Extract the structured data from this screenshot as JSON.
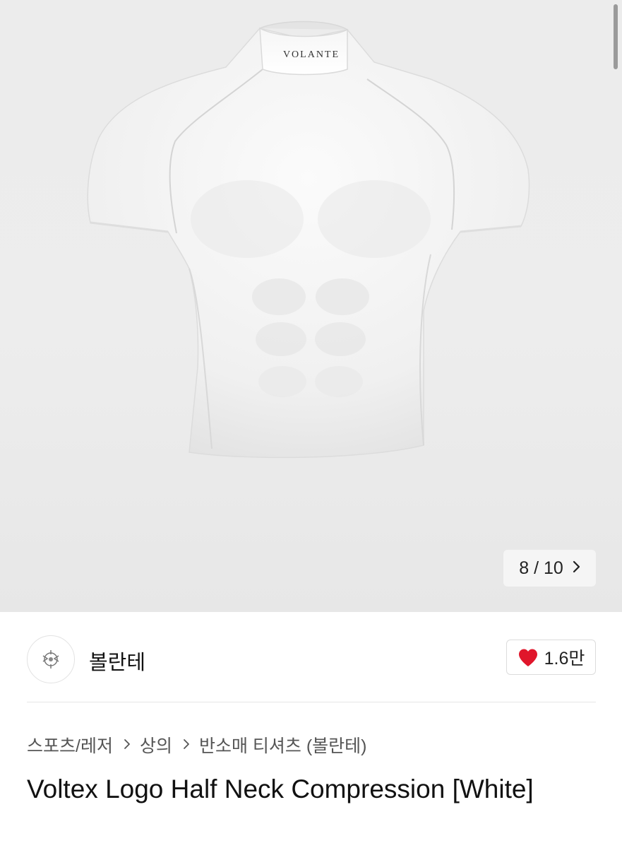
{
  "gallery": {
    "collar_brand_text": "VOLANTE",
    "counter_text": "8 / 10",
    "next_icon": "chevron-right-icon"
  },
  "brand": {
    "name": "볼란테",
    "avatar_icon": "brand-logo-icon"
  },
  "likes": {
    "icon": "heart-icon",
    "count": "1.6만",
    "heart_color": "#e0162b"
  },
  "breadcrumb": {
    "items": [
      "스포츠/레저",
      "상의",
      "반소매 티셔츠 (볼란테)"
    ],
    "separator_icon": "chevron-right-icon"
  },
  "product": {
    "title": "Voltex Logo Half Neck Compression [White]"
  }
}
